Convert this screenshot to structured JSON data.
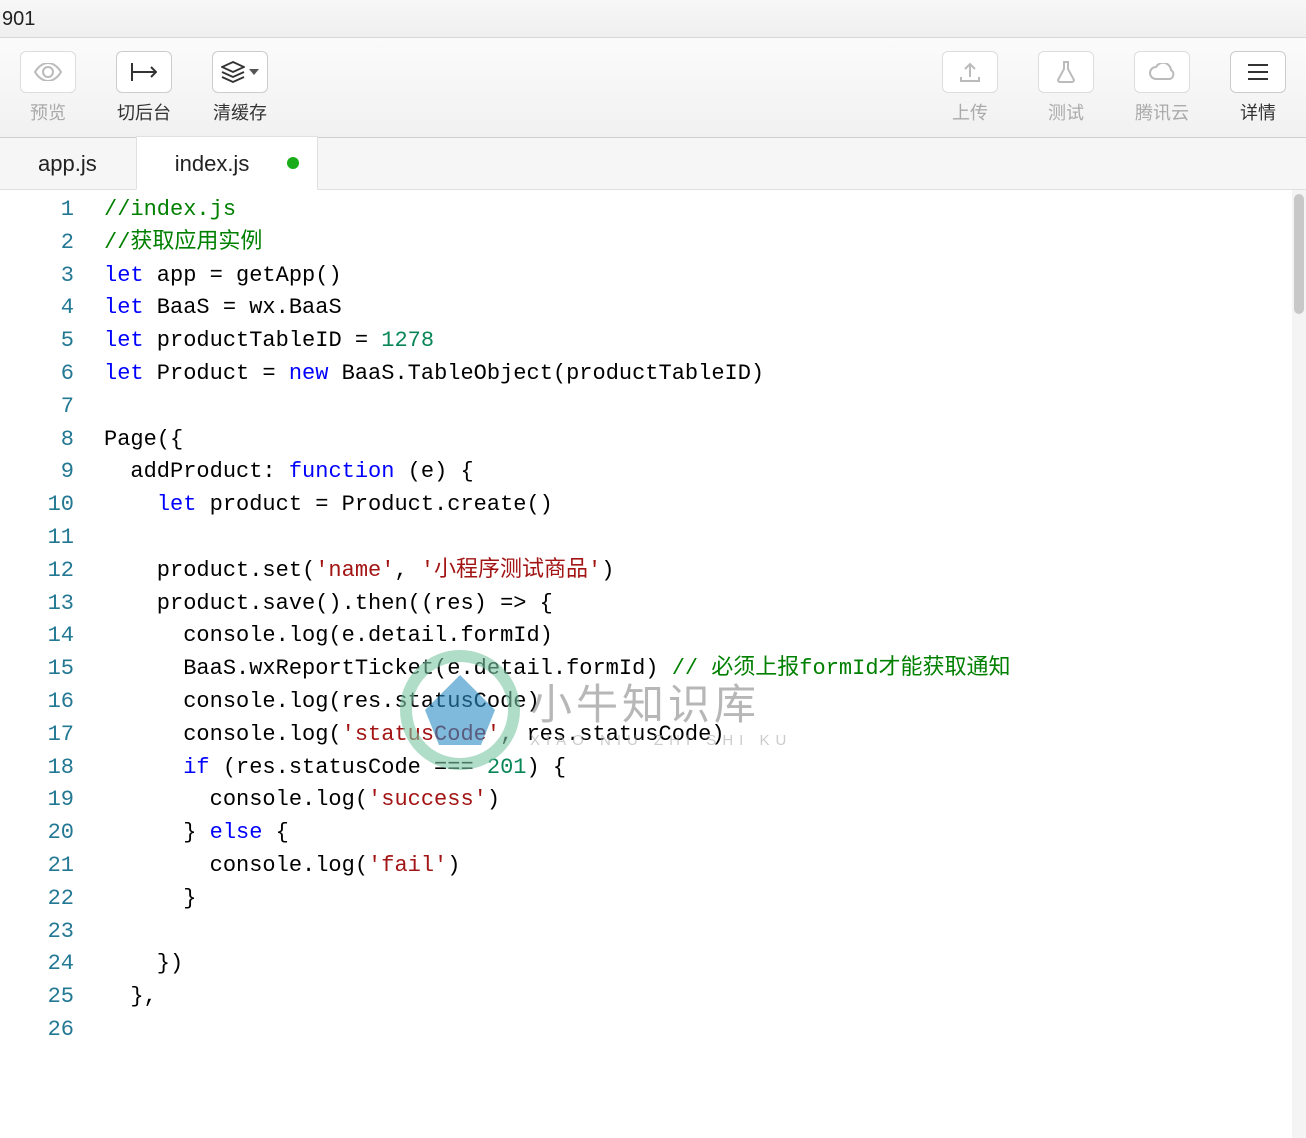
{
  "titlebar": {
    "text": "901"
  },
  "toolbar": {
    "preview_label": "预览",
    "background_label": "切后台",
    "clear_cache_label": "清缓存",
    "upload_label": "上传",
    "test_label": "测试",
    "cloud_label": "腾讯云",
    "details_label": "详情"
  },
  "tabs": [
    {
      "label": "app.js",
      "active": false,
      "dirty": false
    },
    {
      "label": "index.js",
      "active": true,
      "dirty": true
    }
  ],
  "code": {
    "lines": [
      {
        "n": 1,
        "tokens": [
          {
            "t": "//index.js",
            "c": "comment"
          }
        ]
      },
      {
        "n": 2,
        "tokens": [
          {
            "t": "//获取应用实例",
            "c": "comment"
          }
        ]
      },
      {
        "n": 3,
        "tokens": [
          {
            "t": "let",
            "c": "keyword"
          },
          {
            "t": " app = getApp()",
            "c": "plain"
          }
        ]
      },
      {
        "n": 4,
        "tokens": [
          {
            "t": "let",
            "c": "keyword"
          },
          {
            "t": " BaaS = wx.BaaS",
            "c": "plain"
          }
        ]
      },
      {
        "n": 5,
        "tokens": [
          {
            "t": "let",
            "c": "keyword"
          },
          {
            "t": " productTableID = ",
            "c": "plain"
          },
          {
            "t": "1278",
            "c": "number"
          }
        ]
      },
      {
        "n": 6,
        "tokens": [
          {
            "t": "let",
            "c": "keyword"
          },
          {
            "t": " Product = ",
            "c": "plain"
          },
          {
            "t": "new",
            "c": "keyword"
          },
          {
            "t": " BaaS.TableObject(productTableID)",
            "c": "plain"
          }
        ]
      },
      {
        "n": 7,
        "tokens": [
          {
            "t": "",
            "c": "plain"
          }
        ]
      },
      {
        "n": 8,
        "tokens": [
          {
            "t": "Page({",
            "c": "plain"
          }
        ]
      },
      {
        "n": 9,
        "tokens": [
          {
            "t": "  addProduct: ",
            "c": "plain"
          },
          {
            "t": "function",
            "c": "keyword"
          },
          {
            "t": " (e) {",
            "c": "plain"
          }
        ]
      },
      {
        "n": 10,
        "tokens": [
          {
            "t": "    ",
            "c": "plain"
          },
          {
            "t": "let",
            "c": "keyword"
          },
          {
            "t": " product = Product.create()",
            "c": "plain"
          }
        ]
      },
      {
        "n": 11,
        "tokens": [
          {
            "t": "",
            "c": "plain"
          }
        ]
      },
      {
        "n": 12,
        "tokens": [
          {
            "t": "    product.set(",
            "c": "plain"
          },
          {
            "t": "'name'",
            "c": "string"
          },
          {
            "t": ", ",
            "c": "plain"
          },
          {
            "t": "'小程序测试商品'",
            "c": "string"
          },
          {
            "t": ")",
            "c": "plain"
          }
        ]
      },
      {
        "n": 13,
        "tokens": [
          {
            "t": "    product.save().then((res) => {",
            "c": "plain"
          }
        ]
      },
      {
        "n": 14,
        "tokens": [
          {
            "t": "      console.log(e.detail.formId)",
            "c": "plain"
          }
        ]
      },
      {
        "n": 15,
        "tokens": [
          {
            "t": "      BaaS.wxReportTicket(e.detail.formId) ",
            "c": "plain"
          },
          {
            "t": "// 必须上报formId才能获取通知",
            "c": "comment"
          }
        ]
      },
      {
        "n": 16,
        "tokens": [
          {
            "t": "      console.log(res.statusCode)",
            "c": "plain"
          }
        ]
      },
      {
        "n": 17,
        "tokens": [
          {
            "t": "      console.log(",
            "c": "plain"
          },
          {
            "t": "'statusCode'",
            "c": "string"
          },
          {
            "t": ", res.statusCode)",
            "c": "plain"
          }
        ]
      },
      {
        "n": 18,
        "tokens": [
          {
            "t": "      ",
            "c": "plain"
          },
          {
            "t": "if",
            "c": "keyword"
          },
          {
            "t": " (res.statusCode === ",
            "c": "plain"
          },
          {
            "t": "201",
            "c": "number"
          },
          {
            "t": ") {",
            "c": "plain"
          }
        ]
      },
      {
        "n": 19,
        "tokens": [
          {
            "t": "        console.log(",
            "c": "plain"
          },
          {
            "t": "'success'",
            "c": "string"
          },
          {
            "t": ")",
            "c": "plain"
          }
        ]
      },
      {
        "n": 20,
        "tokens": [
          {
            "t": "      } ",
            "c": "plain"
          },
          {
            "t": "else",
            "c": "keyword"
          },
          {
            "t": " {",
            "c": "plain"
          }
        ]
      },
      {
        "n": 21,
        "tokens": [
          {
            "t": "        console.log(",
            "c": "plain"
          },
          {
            "t": "'fail'",
            "c": "string"
          },
          {
            "t": ")",
            "c": "plain"
          }
        ]
      },
      {
        "n": 22,
        "tokens": [
          {
            "t": "      }",
            "c": "plain"
          }
        ]
      },
      {
        "n": 23,
        "tokens": [
          {
            "t": "",
            "c": "plain"
          }
        ]
      },
      {
        "n": 24,
        "tokens": [
          {
            "t": "    })",
            "c": "plain"
          }
        ]
      },
      {
        "n": 25,
        "tokens": [
          {
            "t": "  },",
            "c": "plain"
          }
        ]
      },
      {
        "n": 26,
        "tokens": [
          {
            "t": "",
            "c": "plain"
          }
        ]
      }
    ]
  },
  "watermark": {
    "zh": "小牛知识库",
    "en": "XIAO NIU ZHI SHI KU"
  }
}
